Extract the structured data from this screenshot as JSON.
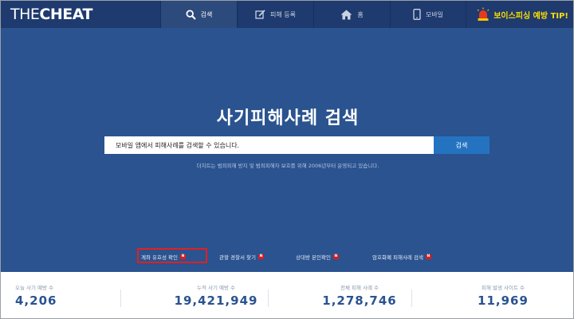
{
  "logo": {
    "part1": "THE",
    "part2": "CHEAT"
  },
  "nav": {
    "search": {
      "label": "검색",
      "icon": "search-icon"
    },
    "report": {
      "label": "피해 등록",
      "icon": "edit-icon"
    },
    "home": {
      "label": "홈",
      "icon": "home-icon"
    },
    "mobile": {
      "label": "모바일",
      "icon": "mobile-icon"
    }
  },
  "tip": {
    "label": "보이스피싱 예방 TIP!",
    "icon": "warning-siren-icon"
  },
  "hero": {
    "title": "사기피해사례 검색",
    "search_placeholder": "모바일 앱에서 피해사례를 검색할 수 있습니다.",
    "search_button": "검색",
    "subtitle": "더치트는 범죄피해 방지 및 범죄피해자 보호를 위해 2006년부터 운영되고 있습니다."
  },
  "links": [
    {
      "label": "계좌 유효성 확인",
      "badge": "N"
    },
    {
      "label": "관할 경찰서 찾기",
      "badge": "N"
    },
    {
      "label": "상대방 본인확인",
      "badge": "N"
    },
    {
      "label": "암호화폐 피해사례 검색",
      "badge": "N"
    }
  ],
  "stats": [
    {
      "label": "오늘 사기 예방 수",
      "value": "4,206"
    },
    {
      "label": "누적 사기 예방 수",
      "value": "19,421,949"
    },
    {
      "label": "전체 피해 사례 수",
      "value": "1,278,746"
    },
    {
      "label": "피해 발생 사이트 수",
      "value": "11,969"
    }
  ],
  "colors": {
    "nav_bg": "#1e3a6e",
    "hero_bg": "#2a5390",
    "accent": "#2473c0",
    "highlight": "#e02020",
    "tip": "#ffde00"
  }
}
